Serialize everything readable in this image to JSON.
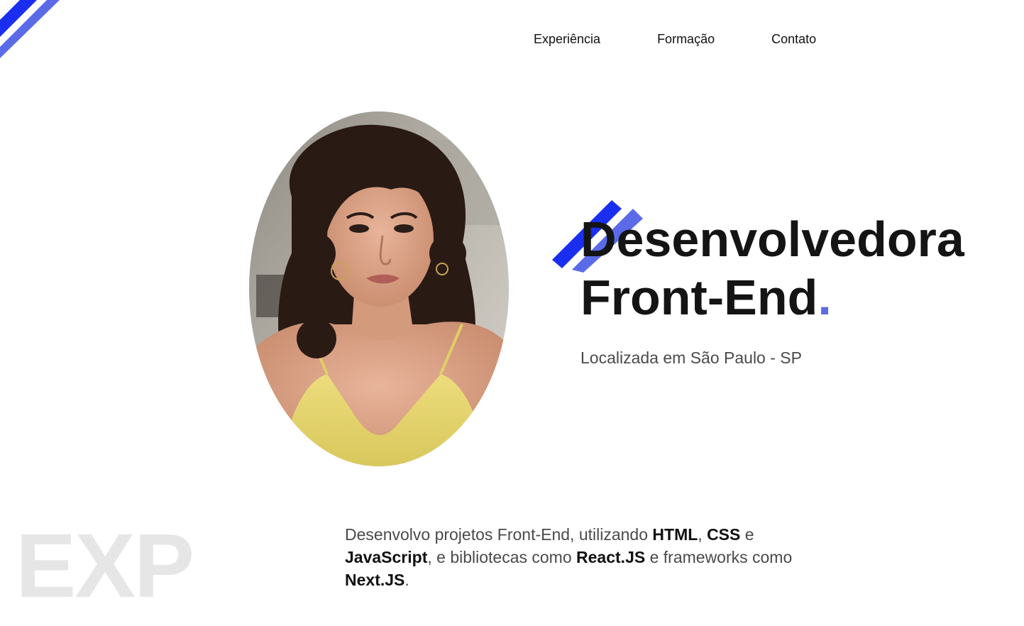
{
  "nav": {
    "items": [
      {
        "label": "Experiência"
      },
      {
        "label": "Formação"
      },
      {
        "label": "Contato"
      }
    ]
  },
  "hero": {
    "title_line1": "Desenvolvedora",
    "title_line2": "Front-End",
    "title_dot": ".",
    "location": "Localizada em São Paulo - SP"
  },
  "about": {
    "t1": "Desenvolvo projetos Front-End, utilizando ",
    "s1": "HTML",
    "t2": ", ",
    "s2": "CSS",
    "t3": " e ",
    "s3": "JavaScript",
    "t4": ", e bibliotecas como ",
    "s4": "React.JS",
    "t5": " e frameworks como ",
    "s5": "Next.JS",
    "t6": "."
  },
  "section": {
    "big_heading": "EXP"
  },
  "colors": {
    "accent_dark": "#1a2ef0",
    "accent_light": "#5b6be8",
    "text": "#141414",
    "muted": "#4a4a4a",
    "faded": "#e6e6e6"
  },
  "icons": {
    "corner": "diagonal-stripes-icon",
    "headline": "diagonal-stripes-icon"
  }
}
